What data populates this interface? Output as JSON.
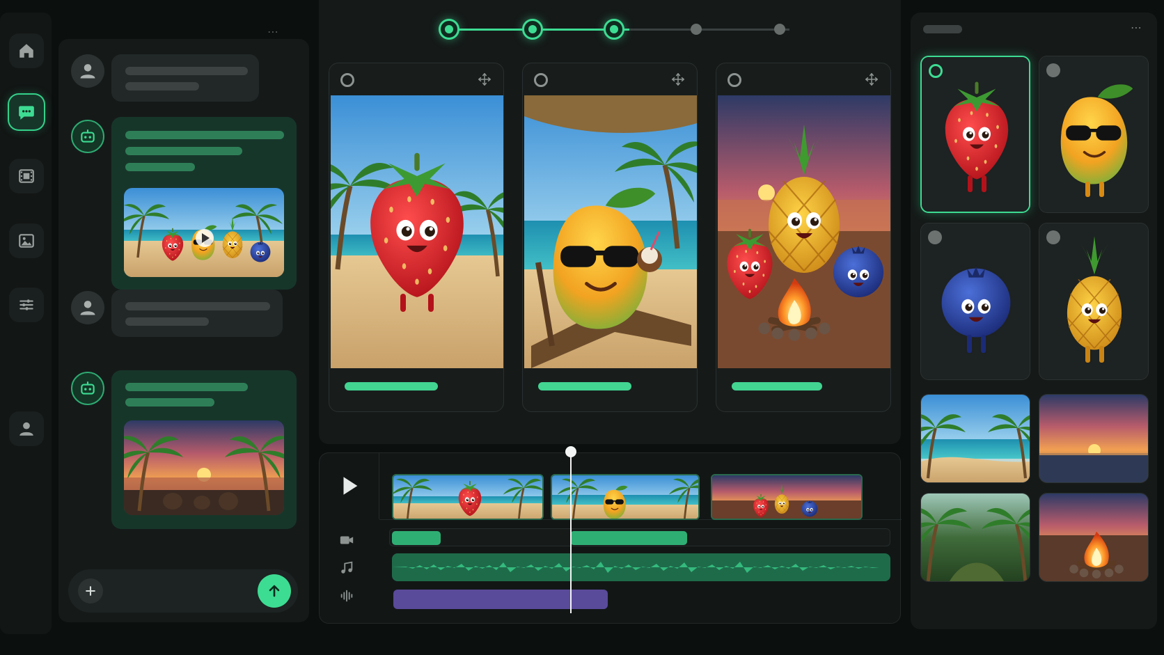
{
  "rail": {
    "items": [
      {
        "id": "home",
        "icon": "home-icon",
        "active": false
      },
      {
        "id": "chat",
        "icon": "chat-icon",
        "active": true
      },
      {
        "id": "video",
        "icon": "film-icon",
        "active": false
      },
      {
        "id": "images",
        "icon": "image-icon",
        "active": false
      },
      {
        "id": "settings",
        "icon": "sliders-icon",
        "active": false
      },
      {
        "id": "profile",
        "icon": "user-icon",
        "active": false
      }
    ]
  },
  "chat": {
    "messages": [
      {
        "role": "user",
        "lines": 2
      },
      {
        "role": "bot",
        "lines": 3,
        "attachment": "beach-group-thumbnail",
        "has_play": true
      },
      {
        "role": "user",
        "lines": 2
      },
      {
        "role": "bot",
        "lines": 2,
        "attachment": "sunset-thumbnail"
      }
    ],
    "composer": {
      "add_icon": "plus-icon",
      "send_icon": "arrow-up-icon"
    }
  },
  "stepper": {
    "total_steps": 5,
    "completed_steps": 3
  },
  "story": {
    "cards": [
      {
        "scene": "strawberry-running-on-beach",
        "selected": false
      },
      {
        "scene": "mango-with-sunglasses-on-lounger",
        "selected": false
      },
      {
        "scene": "fruits-at-sunset-campfire",
        "selected": false
      }
    ]
  },
  "timeline": {
    "play_icon": "play-icon",
    "tracks": [
      "video-track",
      "music-track",
      "audio-track"
    ],
    "clips": [
      "strawberry-scene",
      "mango-scene",
      "campfire-scene"
    ],
    "playhead_fraction": 0.34
  },
  "assets": {
    "characters": [
      {
        "name": "strawberry",
        "selected": true
      },
      {
        "name": "mango",
        "selected": false
      },
      {
        "name": "blueberry",
        "selected": false
      },
      {
        "name": "pineapple",
        "selected": false
      }
    ],
    "backgrounds": [
      "beach-day",
      "ocean-sunset",
      "jungle",
      "beach-campfire"
    ]
  },
  "colors": {
    "accent": "#3ddc93",
    "background": "#0b0f0e",
    "panel": "#151a19",
    "audio": "#5a4a9a"
  }
}
